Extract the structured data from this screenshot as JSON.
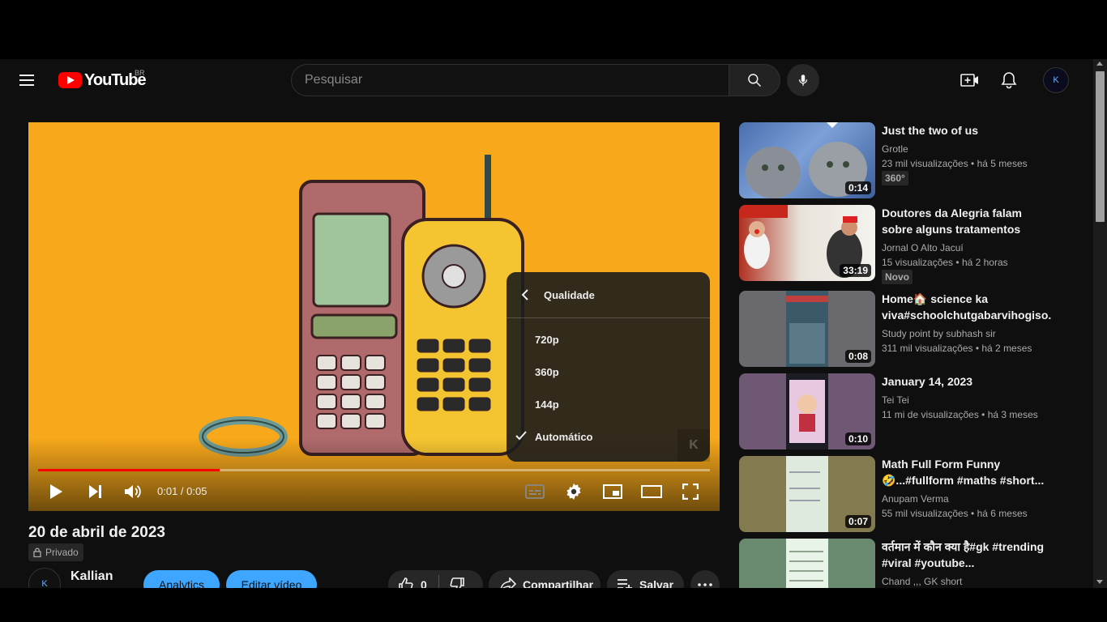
{
  "header": {
    "logo_text": "YouTube",
    "country_code": "BR",
    "search_placeholder": "Pesquisar",
    "avatar_letter": "K"
  },
  "player": {
    "current_time": "0:01",
    "duration": "0:05",
    "time_separator": " / ",
    "progress_fraction": 0.27,
    "watermark": "K",
    "quality_menu": {
      "title": "Qualidade",
      "options": [
        "720p",
        "360p",
        "144p",
        "Automático"
      ],
      "selected": "Automático"
    }
  },
  "video": {
    "title": "20 de abril de 2023",
    "privacy": "Privado",
    "channel_avatar_letter": "K",
    "channel_name": "Kallian",
    "analytics_label": "Analytics",
    "edit_label": "Editar vídeo",
    "like_count": "0",
    "share_label": "Compartilhar",
    "save_label": "Salvar"
  },
  "sidebar": {
    "items": [
      {
        "title": "Just the two of us",
        "channel": "Grotle",
        "views": "23 mil visualizações",
        "age": "há 5 meses",
        "duration": "0:14",
        "badge": "360°"
      },
      {
        "title": "Doutores da Alegria falam sobre alguns tratamentos para...",
        "channel": "Jornal O Alto Jacuí",
        "views": "15 visualizações",
        "age": "há 2 horas",
        "duration": "33:19",
        "badge": "Novo"
      },
      {
        "title": "Home🏠 science ka viva#schoolchutgabarvihogiso...",
        "channel": "Study point by subhash sir",
        "views": "311 mil visualizações",
        "age": "há 2 meses",
        "duration": "0:08",
        "badge": ""
      },
      {
        "title": "January 14, 2023",
        "channel": "Tei Tei",
        "views": "11 mi de visualizações",
        "age": "há 3 meses",
        "duration": "0:10",
        "badge": ""
      },
      {
        "title": "Math Full Form Funny 🤣...#fullform #maths #short...",
        "channel": "Anupam Verma",
        "views": "55 mil visualizações",
        "age": "há 6 meses",
        "duration": "0:07",
        "badge": ""
      },
      {
        "title": "वर्तमान में कौन क्या है#gk #trending #viral #youtube...",
        "channel": "Chand ,,, GK short",
        "views": "",
        "age": "",
        "duration": "",
        "badge": ""
      }
    ]
  },
  "colors": {
    "background": "#0f0f0f",
    "accent_red": "#ff0000",
    "accent_blue": "#3ea6ff",
    "player_bg": "#f7a81b"
  }
}
